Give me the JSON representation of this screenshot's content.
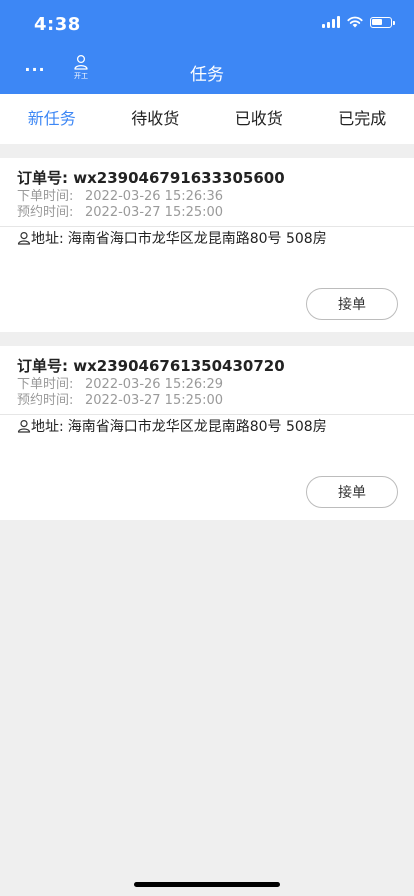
{
  "status_bar": {
    "time": "4:38",
    "battery_level": 0.6
  },
  "nav": {
    "more_label": "···",
    "start_work_label": "开工",
    "title": "任务"
  },
  "tabs": [
    {
      "label": "新任务",
      "active": true
    },
    {
      "label": "待收货",
      "active": false
    },
    {
      "label": "已收货",
      "active": false
    },
    {
      "label": "已完成",
      "active": false
    }
  ],
  "orders": [
    {
      "order_no_label": "订单号:",
      "order_no": "wx239046791633305600",
      "created_label": "下单时间:",
      "created_time": "2022-03-26 15:26:36",
      "scheduled_label": "预约时间:",
      "scheduled_time": "2022-03-27 15:25:00",
      "address_label": "地址:",
      "address": "海南省海口市龙华区龙昆南路80号 508房",
      "action_label": "接单"
    },
    {
      "order_no_label": "订单号:",
      "order_no": "wx239046761350430720",
      "created_label": "下单时间:",
      "created_time": "2022-03-26 15:26:29",
      "scheduled_label": "预约时间:",
      "scheduled_time": "2022-03-27 15:25:00",
      "address_label": "地址:",
      "address": "海南省海口市龙华区龙昆南路80号 508房",
      "action_label": "接单"
    }
  ],
  "colors": {
    "primary": "#3d87f5",
    "background": "#efefef",
    "muted_text": "#9a9a9a"
  }
}
